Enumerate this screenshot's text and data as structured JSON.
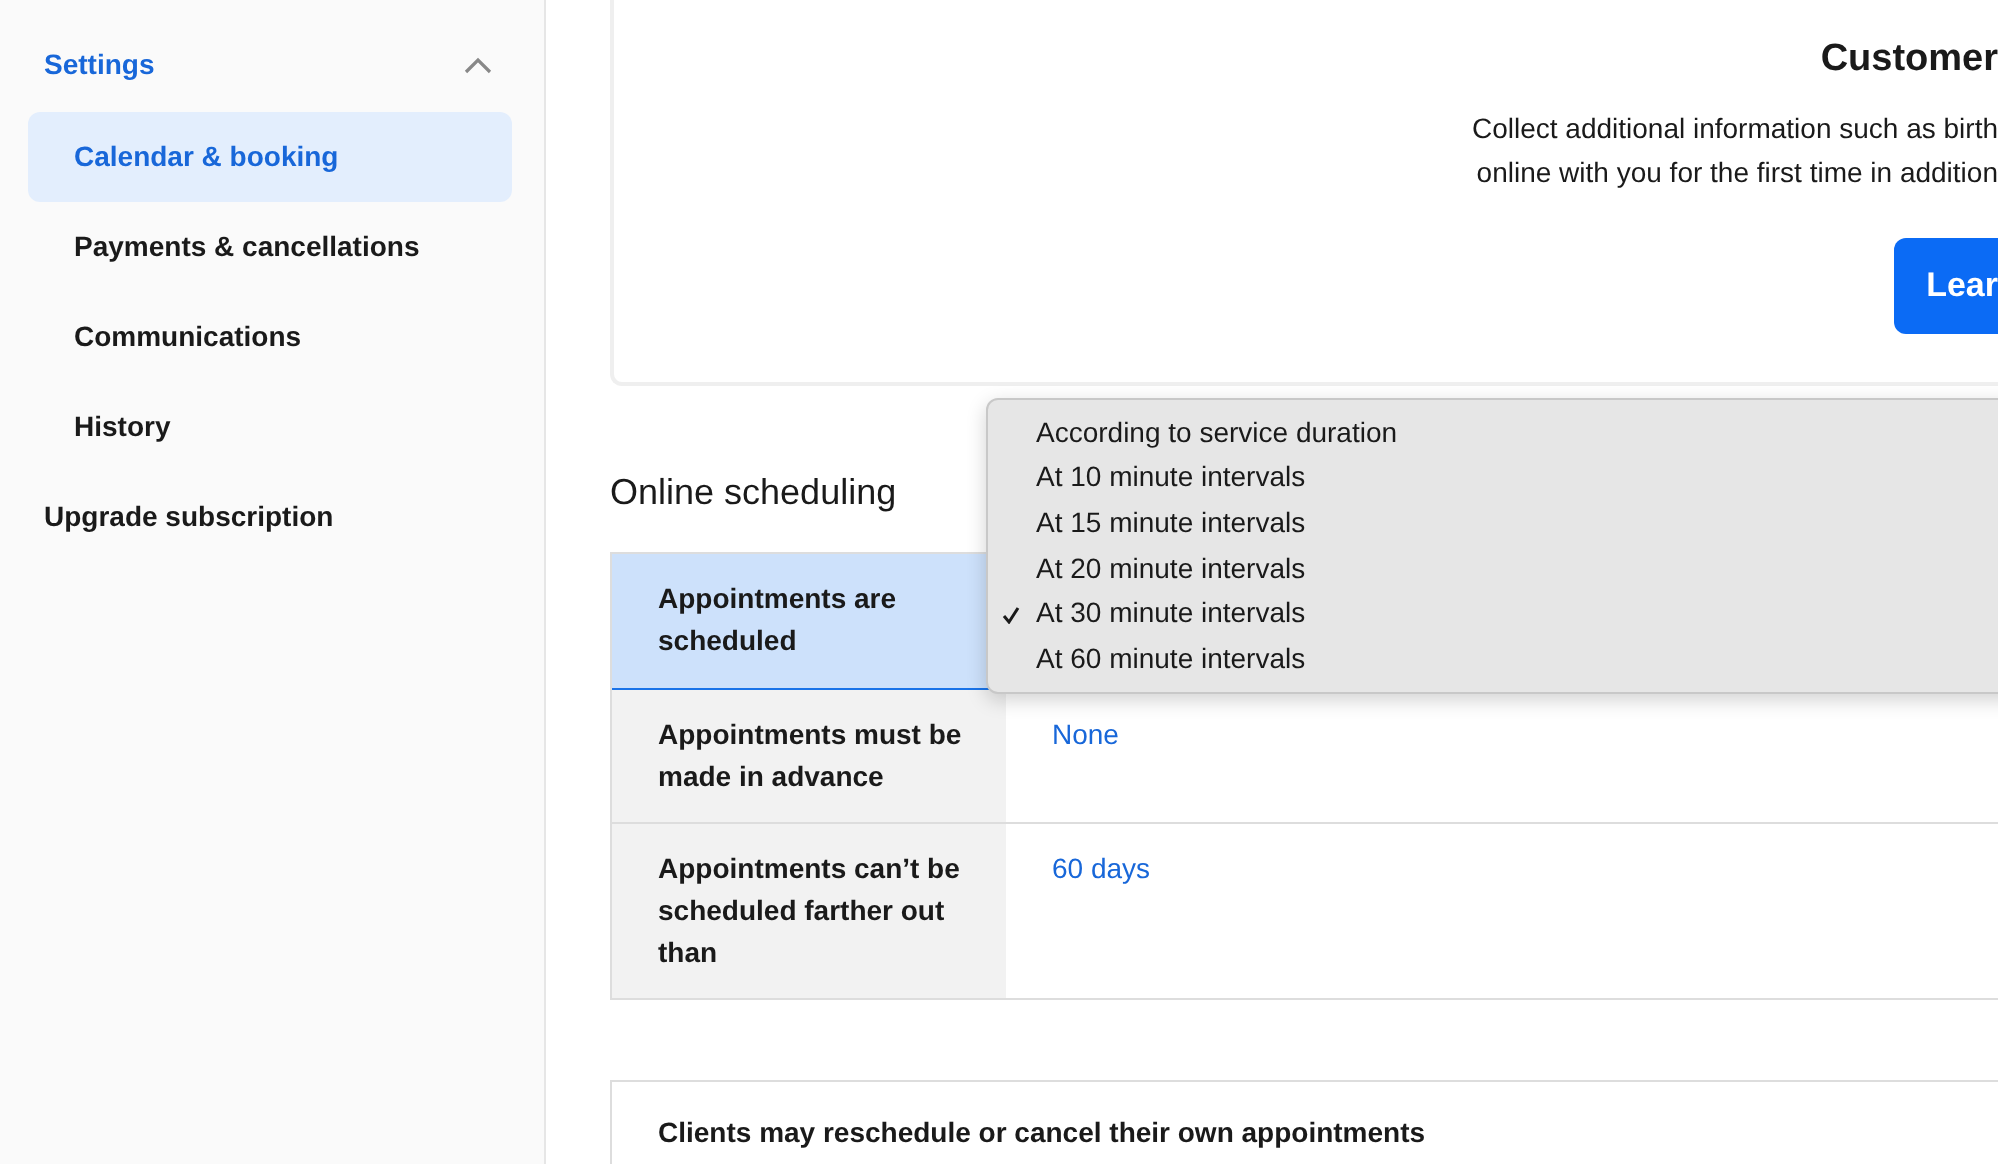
{
  "sidebar": {
    "section": {
      "label": "Settings",
      "expanded": true
    },
    "items": [
      {
        "label": "Calendar & booking",
        "selected": true
      },
      {
        "label": "Payments & cancellations",
        "selected": false
      },
      {
        "label": "Communications",
        "selected": false
      },
      {
        "label": "History",
        "selected": false
      }
    ],
    "bottom_item": {
      "label": "Upgrade subscription"
    }
  },
  "promo_card": {
    "title": "Customer",
    "lines": [
      "Collect additional information such as birth",
      "online with you for the first time in addition"
    ],
    "button": "Lear"
  },
  "online_scheduling": {
    "title": "Online scheduling",
    "rows": [
      {
        "label": "Appointments are scheduled",
        "value": "",
        "selected": true
      },
      {
        "label": "Appointments must be made in advance",
        "value": "None",
        "selected": false
      },
      {
        "label": "Appointments can’t be scheduled farther out than",
        "value": "60 days",
        "selected": false
      }
    ],
    "dropdown": {
      "options": [
        {
          "label": "According to service duration",
          "checked": false
        },
        {
          "label": "At 10 minute intervals",
          "checked": false
        },
        {
          "label": "At 15 minute intervals",
          "checked": false
        },
        {
          "label": "At 20 minute intervals",
          "checked": false
        },
        {
          "label": "At 30 minute intervals",
          "checked": true
        },
        {
          "label": "At 60 minute intervals",
          "checked": false
        }
      ]
    }
  },
  "reschedule_card": {
    "title": "Clients may reschedule or cancel their own appointments"
  }
}
